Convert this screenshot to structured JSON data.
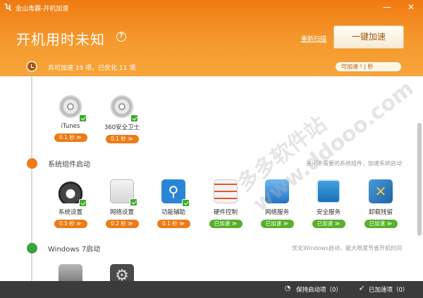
{
  "window": {
    "title": "金山毒霸-开机加速",
    "minimize_symbol": "—",
    "close_symbol": "✕"
  },
  "header": {
    "headline": "开机用时未知",
    "help_symbol": "?",
    "rescan_label": "重新扫描",
    "speedup_button": "一键加速",
    "summary": "共可加速 19 项，已优化 11 项",
    "speed_pill": "可加速 ! | 秒"
  },
  "sections": [
    {
      "title": "",
      "hint": "",
      "items": [
        {
          "label": "iTunes",
          "time": "0.1 秒 ≫",
          "status": "orange",
          "icon": "disc-icon",
          "checked": true
        },
        {
          "label": "360安全卫士",
          "time": "0.1 秒 ≫",
          "status": "orange",
          "icon": "disc-icon",
          "checked": true
        }
      ]
    },
    {
      "title": "系统组件启动",
      "hint": "关闭不需要的系统组件，加速系统启动",
      "items": [
        {
          "label": "系统设置",
          "time": "0.5 秒 ≫",
          "status": "orange",
          "icon": "gauge-icon",
          "checked": true
        },
        {
          "label": "网络设置",
          "time": "0.2 秒 ≫",
          "status": "orange",
          "icon": "network-chart-icon",
          "checked": true
        },
        {
          "label": "功能辅助",
          "time": "0.1 秒 ≫",
          "status": "orange",
          "icon": "accessibility-icon",
          "checked": true
        },
        {
          "label": "硬件控制",
          "time": "已加速 ≫",
          "status": "green",
          "icon": "hardware-control-icon",
          "checked": false
        },
        {
          "label": "网络服务",
          "time": "已加速 ≫",
          "status": "green",
          "icon": "network-service-icon",
          "checked": false
        },
        {
          "label": "安全服务",
          "time": "已加速 ≫",
          "status": "green",
          "icon": "security-monitor-icon",
          "checked": false
        },
        {
          "label": "卸载残留",
          "time": "已加速 ≫",
          "status": "green",
          "icon": "tools-icon",
          "checked": false
        }
      ]
    },
    {
      "title": "Windows 7启动",
      "hint": "优化Windows启动，最大限度节省开机时间",
      "items": [
        {
          "label": "",
          "icon": "drive-icon"
        },
        {
          "label": "",
          "icon": "gear-icon"
        }
      ]
    }
  ],
  "footer": {
    "keep_label": "保持启动项（0）",
    "accelerated_label": "已加速项（0）"
  },
  "watermark": "多多软件站 www.ddooo.com",
  "colors": {
    "accent_orange": "#f07a12",
    "pill_orange": "#ee7b16",
    "pill_green": "#57b12a",
    "footer_bg": "#3b3b3b"
  }
}
